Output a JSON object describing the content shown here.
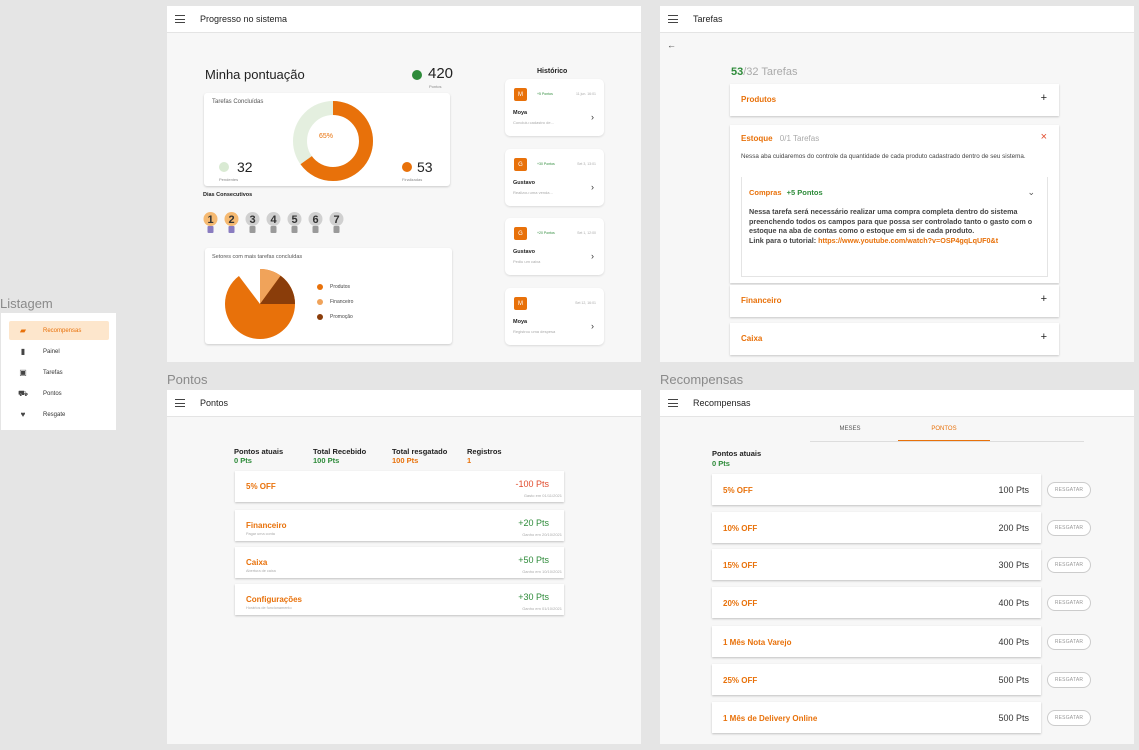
{
  "labels": {
    "listagem": "Listagem",
    "pontos_frame": "Pontos",
    "recompensas_frame": "Recompensas"
  },
  "sidebar": {
    "items": [
      {
        "label": "Recompensas",
        "icon": "folder-icon",
        "active": true
      },
      {
        "label": "Painel",
        "icon": "file-icon",
        "active": false
      },
      {
        "label": "Tarefas",
        "icon": "calendar-icon",
        "active": false
      },
      {
        "label": "Pontos",
        "icon": "cart-icon",
        "active": false
      },
      {
        "label": "Resgate",
        "icon": "heart-icon",
        "active": false
      }
    ]
  },
  "progress": {
    "appbar_title": "Progresso no sistema",
    "heading": "Minha pontuação",
    "points_value": "420",
    "points_label": "Pontos",
    "tasks_card_title": "Tarefas Concluídas",
    "donut_center": "65%",
    "donut_fraction": 0.65,
    "pending_value": "32",
    "pending_label": "Pendentes",
    "done_value": "53",
    "done_label": "Finalizadas",
    "streak_title": "Dias Consecutivos",
    "streak_days": [
      "1",
      "2",
      "3",
      "4",
      "5",
      "6",
      "7"
    ],
    "streak_active_count": 2,
    "sectors_title": "Setores com mais tarefas concluídas",
    "sectors_legend": [
      {
        "label": "Produtos",
        "color": "#e8710a"
      },
      {
        "label": "Financeiro",
        "color": "#f0a35a"
      },
      {
        "label": "Promoção",
        "color": "#8a3d0a"
      }
    ],
    "history_title": "Histórico",
    "history": [
      {
        "avatar": "M",
        "points": "+5 Pontos",
        "date": "11 jun. 16:01",
        "name": "Moya",
        "desc": "Concluiu cadastro de..."
      },
      {
        "avatar": "G",
        "points": "+30 Pontos",
        "date": "Set 3, 13:01",
        "name": "Gustavo",
        "desc": "Realizou uma venda..."
      },
      {
        "avatar": "G",
        "points": "+20 Pontos",
        "date": "Set 1, 12:00",
        "name": "Gustavo",
        "desc": "Pediu um caixa"
      },
      {
        "avatar": "M",
        "points": "",
        "date": "Set 12, 16:01",
        "name": "Moya",
        "desc": "Registrou uma despesa"
      }
    ]
  },
  "tasks": {
    "appbar_title": "Tarefas",
    "done_count": "53",
    "total_label": "/32 Tarefas",
    "rows": [
      {
        "label": "Produtos"
      },
      {
        "label": "Financeiro"
      },
      {
        "label": "Caixa"
      }
    ],
    "expanded": {
      "label": "Estoque",
      "count": "0/1 Tarefas",
      "desc": "Nessa aba cuidaremos do controle da quantidade de cada produto cadastrado dentro de seu sistema.",
      "sub_title": "Compras",
      "sub_points": "+5 Pontos",
      "sub_body": "Nessa tarefa será necessário realizar uma compra completa dentro do sistema preenchendo todos os campos para que possa ser controlado tanto o gasto com o estoque na aba de contas como o estoque em si de cada produto.",
      "sub_link_prefix": "Link para o tutorial:",
      "sub_link": "https://www.youtube.com/watch?v=OSP4gqLqUF0&t"
    }
  },
  "points": {
    "appbar_title": "Pontos",
    "stats": [
      {
        "label": "Pontos atuais",
        "value": "0 Pts",
        "color": "#2e8b3a"
      },
      {
        "label": "Total Recebido",
        "value": "100 Pts",
        "color": "#2e8b3a"
      },
      {
        "label": "Total resgatado",
        "value": "100 Pts",
        "color": "#e8710a"
      },
      {
        "label": "Registros",
        "value": "1",
        "color": "#e8710a"
      }
    ],
    "rows": [
      {
        "title": "5% OFF",
        "sub": "",
        "value": "-100 Pts",
        "date": "Gasto em 01/11/2021",
        "color": "#e14b2c"
      },
      {
        "title": "Financeiro",
        "sub": "Pagar uma conta",
        "value": "+20 Pts",
        "date": "Ganho em 20/10/2021",
        "color": "#2e8b3a"
      },
      {
        "title": "Caixa",
        "sub": "Abertura de caixa",
        "value": "+50 Pts",
        "date": "Ganho em 10/10/2021",
        "color": "#2e8b3a"
      },
      {
        "title": "Configurações",
        "sub": "Horários de funcionamento",
        "value": "+30 Pts",
        "date": "Ganho em 01/10/2021",
        "color": "#2e8b3a"
      }
    ]
  },
  "rewards": {
    "appbar_title": "Recompensas",
    "tabs": [
      {
        "label": "MESES",
        "active": false
      },
      {
        "label": "PONTOS",
        "active": true
      }
    ],
    "current_label": "Pontos atuais",
    "current_value": "0 Pts",
    "button_label": "RESGATAR",
    "items": [
      {
        "title": "5% OFF",
        "value": "100 Pts"
      },
      {
        "title": "10% OFF",
        "value": "200 Pts"
      },
      {
        "title": "15% OFF",
        "value": "300 Pts"
      },
      {
        "title": "20% OFF",
        "value": "400 Pts"
      },
      {
        "title": "1 Mês Nota Varejo",
        "value": "400 Pts"
      },
      {
        "title": "25% OFF",
        "value": "500 Pts"
      },
      {
        "title": "1 Mês de Delivery Online",
        "value": "500 Pts"
      }
    ]
  },
  "colors": {
    "accent": "#e8710a",
    "accent_light": "#f0a35a",
    "accent_dark": "#8a3d0a",
    "positive": "#2e8b3a",
    "negative": "#e14b2c",
    "donut_track": "#e4efdf",
    "pending_dot": "#d9ead3",
    "bulb_active": "#f5b971",
    "bulb_inactive": "#d0d0d0"
  }
}
